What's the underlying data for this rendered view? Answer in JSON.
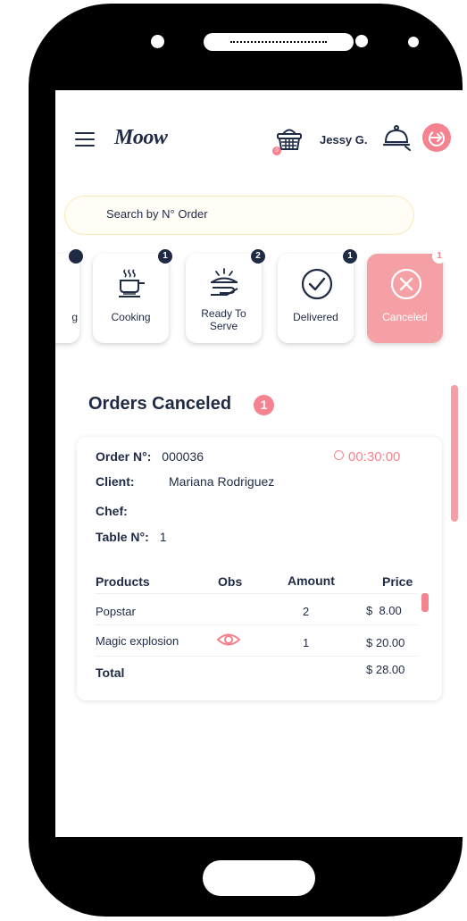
{
  "header": {
    "logo_text": "Moow",
    "user_name": "Jessy G.",
    "cart_count": "0"
  },
  "search": {
    "placeholder": "Search by N° Order"
  },
  "status_cards": [
    {
      "label": "Cooking",
      "badge": "1",
      "icon": "cooking-pot-icon"
    },
    {
      "label": "Ready To Serve",
      "badge": "2",
      "icon": "serving-hand-icon"
    },
    {
      "label": "Delivered",
      "badge": "1",
      "icon": "check-circle-icon"
    },
    {
      "label": "Canceled",
      "badge": "1",
      "icon": "x-circle-icon",
      "active": true
    }
  ],
  "orders": {
    "title": "Orders Canceled",
    "count": "1"
  },
  "order": {
    "number_label": "Order N°:",
    "number": "000036",
    "timer": "00:30:00",
    "client_label": "Client:",
    "client": "Mariana Rodriguez",
    "chef_label": "Chef:",
    "chef": "",
    "table_label": "Table N°:",
    "table": "1",
    "columns": [
      "Products",
      "Obs",
      "Amount",
      "Price"
    ],
    "items": [
      {
        "product": "Popstar",
        "amount": "2",
        "price": "$  8.00",
        "has_obs": false
      },
      {
        "product": "Magic explosion",
        "amount": "1",
        "price": "$ 20.00",
        "has_obs": true
      }
    ],
    "total_label": "Total",
    "total": "$ 28.00"
  },
  "colors": {
    "accent": "#f4838f",
    "active_card": "#f4a0a4",
    "text": "#1f2a44",
    "search_border": "#fbe7b7"
  }
}
